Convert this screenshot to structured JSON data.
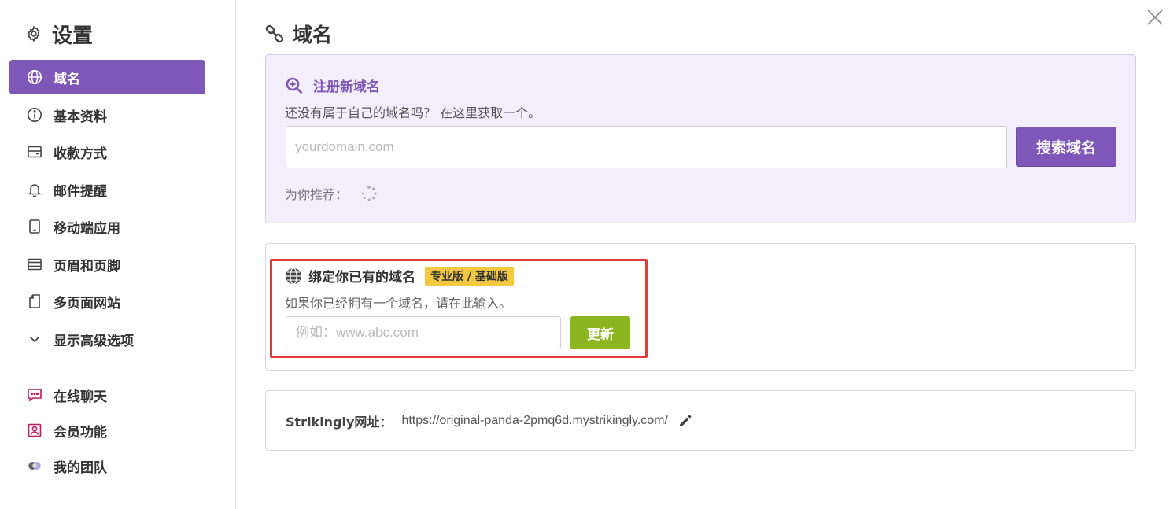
{
  "sidebar": {
    "title": "设置",
    "items": [
      {
        "label": "域名",
        "icon": "globe-icon",
        "active": true
      },
      {
        "label": "基本资料",
        "icon": "info-icon"
      },
      {
        "label": "收款方式",
        "icon": "wallet-icon"
      },
      {
        "label": "邮件提醒",
        "icon": "bell-icon"
      },
      {
        "label": "移动端应用",
        "icon": "mobile-icon"
      },
      {
        "label": "页眉和页脚",
        "icon": "layout-icon"
      },
      {
        "label": "多页面网站",
        "icon": "pages-icon"
      },
      {
        "label": "显示高级选项",
        "icon": "chevron-down-icon"
      }
    ],
    "extra_items": [
      {
        "label": "在线聊天",
        "icon": "chat-icon",
        "color": "#c2185b"
      },
      {
        "label": "会员功能",
        "icon": "member-icon",
        "color": "#c2185b"
      },
      {
        "label": "我的团队",
        "icon": "team-icon"
      }
    ]
  },
  "main": {
    "title": "域名",
    "register": {
      "title": "注册新域名",
      "description": "还没有属于自己的域名吗？ 在这里获取一个。",
      "placeholder": "yourdomain.com",
      "button": "搜索域名",
      "recommend_label": "为你推荐："
    },
    "bind": {
      "title": "绑定你已有的域名",
      "badge": "专业版 / 基础版",
      "description": "如果你已经拥有一个域名，请在此输入。",
      "placeholder": "例如：www.abc.com",
      "button": "更新"
    },
    "site_url": {
      "label": "Strikingly网址：",
      "value": "https://original-panda-2pmq6d.mystrikingly.com/"
    }
  },
  "colors": {
    "accent": "#7e57b8",
    "update_button": "#8db51f",
    "badge": "#f5c842",
    "highlight": "#e53935"
  }
}
